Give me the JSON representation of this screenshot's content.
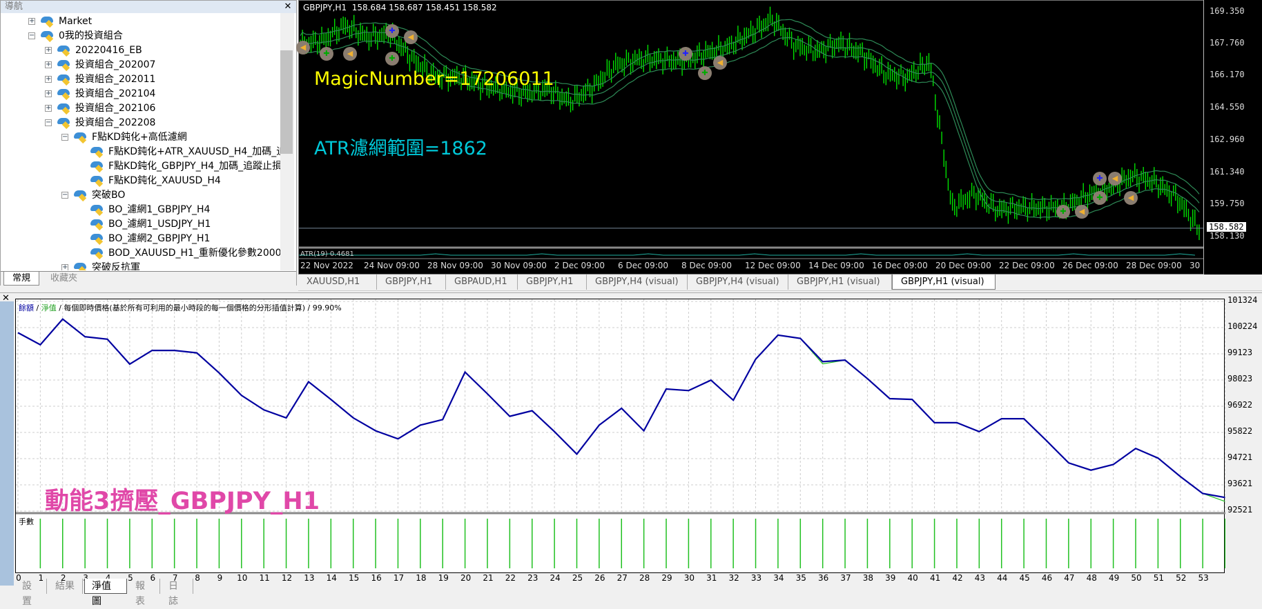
{
  "navigator": {
    "title": "導航",
    "tree": [
      {
        "label": "Market",
        "level": 0,
        "expander": "+"
      },
      {
        "label": "0我的投資組合",
        "level": 0,
        "expander": "−"
      },
      {
        "label": "20220416_EB",
        "level": 1,
        "expander": "+"
      },
      {
        "label": "投資組合_202007",
        "level": 1,
        "expander": "+"
      },
      {
        "label": "投資組合_202011",
        "level": 1,
        "expander": "+"
      },
      {
        "label": "投資組合_202104",
        "level": 1,
        "expander": "+"
      },
      {
        "label": "投資組合_202106",
        "level": 1,
        "expander": "+"
      },
      {
        "label": "投資組合_202208",
        "level": 1,
        "expander": "−"
      },
      {
        "label": "F點KD鈍化+高低濾網",
        "level": 2,
        "expander": "−"
      },
      {
        "label": "F點KD鈍化+ATR_XAUUSD_H4_加碼_追",
        "level": 3,
        "expander": ""
      },
      {
        "label": "F點KD鈍化_GBPJPY_H4_加碼_追蹤止損",
        "level": 3,
        "expander": ""
      },
      {
        "label": "F點KD鈍化_XAUUSD_H4",
        "level": 3,
        "expander": ""
      },
      {
        "label": "突破BO",
        "level": 2,
        "expander": "−"
      },
      {
        "label": "BO_濾網1_GBPJPY_H4",
        "level": 3,
        "expander": ""
      },
      {
        "label": "BO_濾網1_USDJPY_H1",
        "level": 3,
        "expander": ""
      },
      {
        "label": "BO_濾網2_GBPJPY_H1",
        "level": 3,
        "expander": ""
      },
      {
        "label": "BOD_XAUUSD_H1_重新優化參數2000",
        "level": 3,
        "expander": ""
      },
      {
        "label": "突破反抗軍",
        "level": 2,
        "expander": "+"
      }
    ],
    "tabs": [
      {
        "label": "常規",
        "active": true
      },
      {
        "label": "收藏夾",
        "active": false
      }
    ]
  },
  "chart": {
    "header": "GBPJPY,H1  158.684 158.687 158.451 158.582",
    "magic_text": "MagicNumber=17206011",
    "atr_text": "ATR濾網範圍=1862",
    "atr_label": "ATR(19) 0.4681",
    "price_labels": [
      "169.350",
      "167.760",
      "166.170",
      "164.550",
      "162.960",
      "161.340",
      "159.750",
      "158.130"
    ],
    "price_values": [
      169.35,
      167.76,
      166.17,
      164.55,
      162.96,
      161.34,
      159.75,
      158.13
    ],
    "current_price": "158.582",
    "time_labels": [
      "22 Nov 2022",
      "24 Nov 09:00",
      "28 Nov 09:00",
      "30 Nov 09:00",
      "2 Dec 09:00",
      "6 Dec 09:00",
      "8 Dec 09:00",
      "12 Dec 09:00",
      "14 Dec 09:00",
      "16 Dec 09:00",
      "20 Dec 09:00",
      "22 Dec 09:00",
      "26 Dec 09:00",
      "28 Dec 09:00",
      "30 Dec 09:00"
    ],
    "price_path": [
      167.74,
      167.94,
      168.7,
      168.1,
      168.26,
      167.0,
      166.13,
      166.13,
      165.75,
      165.5,
      165.3,
      165.53,
      164.9,
      165.6,
      166.7,
      167.0,
      167.0,
      166.9,
      167.3,
      167.6,
      168.3,
      169.0,
      167.7,
      167.4,
      167.8,
      167.3,
      166.3,
      166.1,
      166.9,
      159.6,
      160.3,
      159.5,
      159.6,
      159.6,
      159.6,
      160.2,
      160.6,
      161.2,
      160.9,
      160.1,
      158.5
    ],
    "colors": {
      "bars": "#00e000",
      "bands": "#2e8b57",
      "background": "#000000",
      "magic": "#ffff00",
      "atr": "#00c8d8"
    },
    "tabs": [
      {
        "label": "XAUUSD,H1"
      },
      {
        "label": "GBPJPY,H1"
      },
      {
        "label": "GBPAUD,H1"
      },
      {
        "label": "GBPJPY,H1"
      },
      {
        "label": "GBPJPY,H4 (visual)"
      },
      {
        "label": "GBPJPY,H4 (visual)"
      },
      {
        "label": "GBPJPY,H1 (visual)"
      },
      {
        "label": "GBPJPY,H1 (visual)",
        "active": true
      }
    ]
  },
  "tester": {
    "legend": {
      "balance": "餘額",
      "equity": "淨值",
      "sep": " / ",
      "model": "每個即時價格(基於所有可利用的最小時段的每一個價格的分形插值計算)",
      "quality": "99.90%"
    },
    "strategy_name": "動能3擠壓_GBPJPY_H1",
    "volume_label": "手數",
    "tabs": [
      {
        "label": "設置"
      },
      {
        "label": "結果"
      },
      {
        "label": "淨值圖",
        "active": true
      },
      {
        "label": "報表"
      },
      {
        "label": "日誌"
      }
    ]
  },
  "chart_data": {
    "type": "line",
    "x_tick_labels": [
      "0",
      "1",
      "2",
      "3",
      "4",
      "5",
      "6",
      "7",
      "8",
      "9",
      "10",
      "11",
      "12",
      "13",
      "14",
      "15",
      "16",
      "17",
      "18",
      "19",
      "20",
      "21",
      "22",
      "23",
      "24",
      "25",
      "26",
      "27",
      "28",
      "29",
      "30",
      "31",
      "32",
      "33",
      "34",
      "35",
      "36",
      "37",
      "38",
      "39",
      "40",
      "41",
      "42",
      "43",
      "44",
      "45",
      "46",
      "47",
      "48",
      "49",
      "50",
      "51",
      "52",
      "53"
    ],
    "y_tick_labels": [
      "101324",
      "100224",
      "99123",
      "98023",
      "96922",
      "95822",
      "94721",
      "93621",
      "92521"
    ],
    "ylim": [
      92521,
      101324
    ],
    "grid": true,
    "series": [
      {
        "name": "餘額",
        "color": "#0000a0",
        "values": [
          100008,
          99502,
          100582,
          99840,
          99738,
          98692,
          99266,
          99266,
          99165,
          98321,
          97377,
          96769,
          96432,
          97950,
          97208,
          96432,
          95892,
          95554,
          96128,
          96364,
          98355,
          97444,
          96499,
          96735,
          95858,
          94913,
          96128,
          96836,
          95892,
          97646,
          97579,
          98018,
          97174,
          98895,
          99907,
          99772,
          98794,
          98861,
          98085,
          97242,
          97208,
          96229,
          96229,
          95858,
          96398,
          96398,
          95487,
          94543,
          94239,
          94475,
          95150,
          94745,
          93968,
          93260,
          93092
        ]
      },
      {
        "name": "淨值",
        "color": "#20c020",
        "values": [
          100008,
          99502,
          100582,
          99840,
          99738,
          98692,
          99266,
          99266,
          99165,
          98321,
          97377,
          96769,
          96432,
          97950,
          97208,
          96432,
          95892,
          95554,
          96128,
          96364,
          98355,
          97444,
          96499,
          96735,
          95858,
          94913,
          96128,
          96836,
          95892,
          97646,
          97579,
          98018,
          97174,
          98895,
          99907,
          99772,
          98700,
          98861,
          98085,
          97242,
          97208,
          96229,
          96229,
          95858,
          96398,
          96398,
          95487,
          94543,
          94239,
          94475,
          95150,
          94745,
          93968,
          93260,
          92923
        ]
      }
    ],
    "volume": {
      "label": "手數",
      "values": [
        0,
        1,
        1,
        1,
        1,
        1,
        1,
        1,
        1,
        1,
        1,
        1,
        1,
        1,
        1,
        1,
        1,
        1,
        1,
        1,
        1,
        1,
        1,
        1,
        1,
        1,
        1,
        1,
        1,
        1,
        1,
        1,
        1,
        1,
        1,
        1,
        1,
        1,
        1,
        1,
        1,
        1,
        1,
        1,
        1,
        1,
        1,
        1,
        1,
        1,
        1,
        1,
        1,
        1,
        1
      ]
    }
  }
}
